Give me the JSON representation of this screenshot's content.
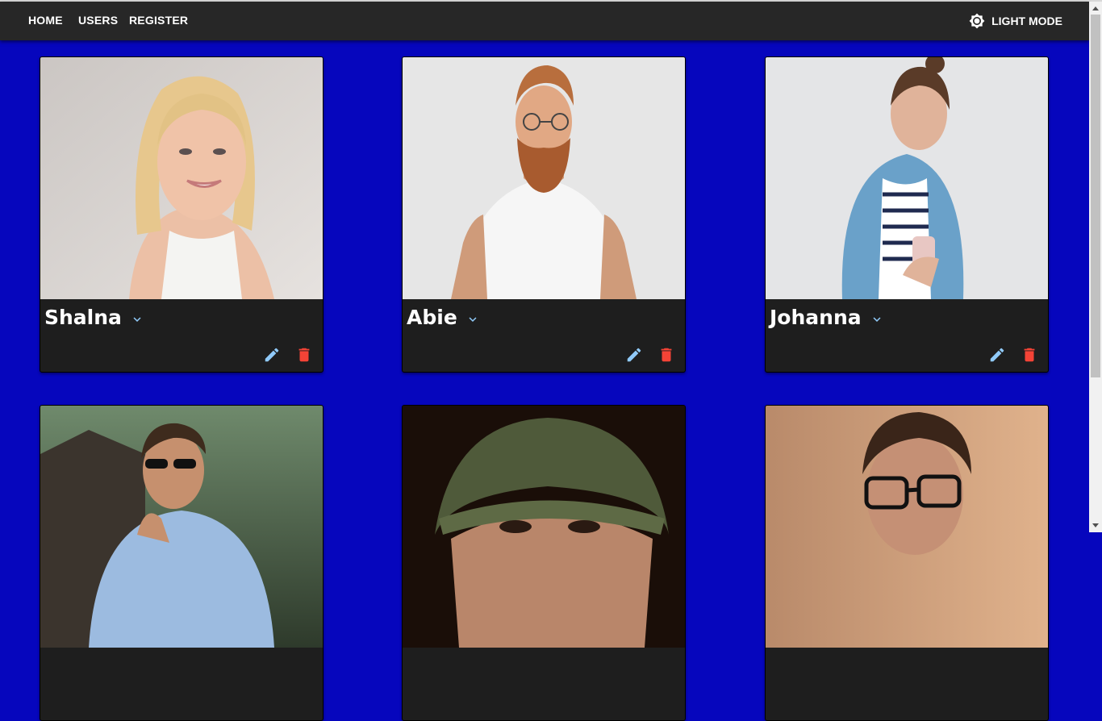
{
  "nav": {
    "home": "HOME",
    "users": "USERS",
    "register": "REGISTER",
    "theme_toggle": "LIGHT MODE",
    "theme_icon": "brightness-icon"
  },
  "colors": {
    "page_background": "#0606bd",
    "navbar": "#272727",
    "card": "#1e1e1e",
    "edit_icon": "#90caf9",
    "delete_icon": "#f44336"
  },
  "users": [
    {
      "name": "Shalna"
    },
    {
      "name": "Abie"
    },
    {
      "name": "Johanna"
    },
    {
      "name": ""
    },
    {
      "name": ""
    },
    {
      "name": ""
    }
  ],
  "card_icons": {
    "expand": "chevron-down-icon",
    "edit": "pencil-icon",
    "delete": "trash-icon"
  }
}
